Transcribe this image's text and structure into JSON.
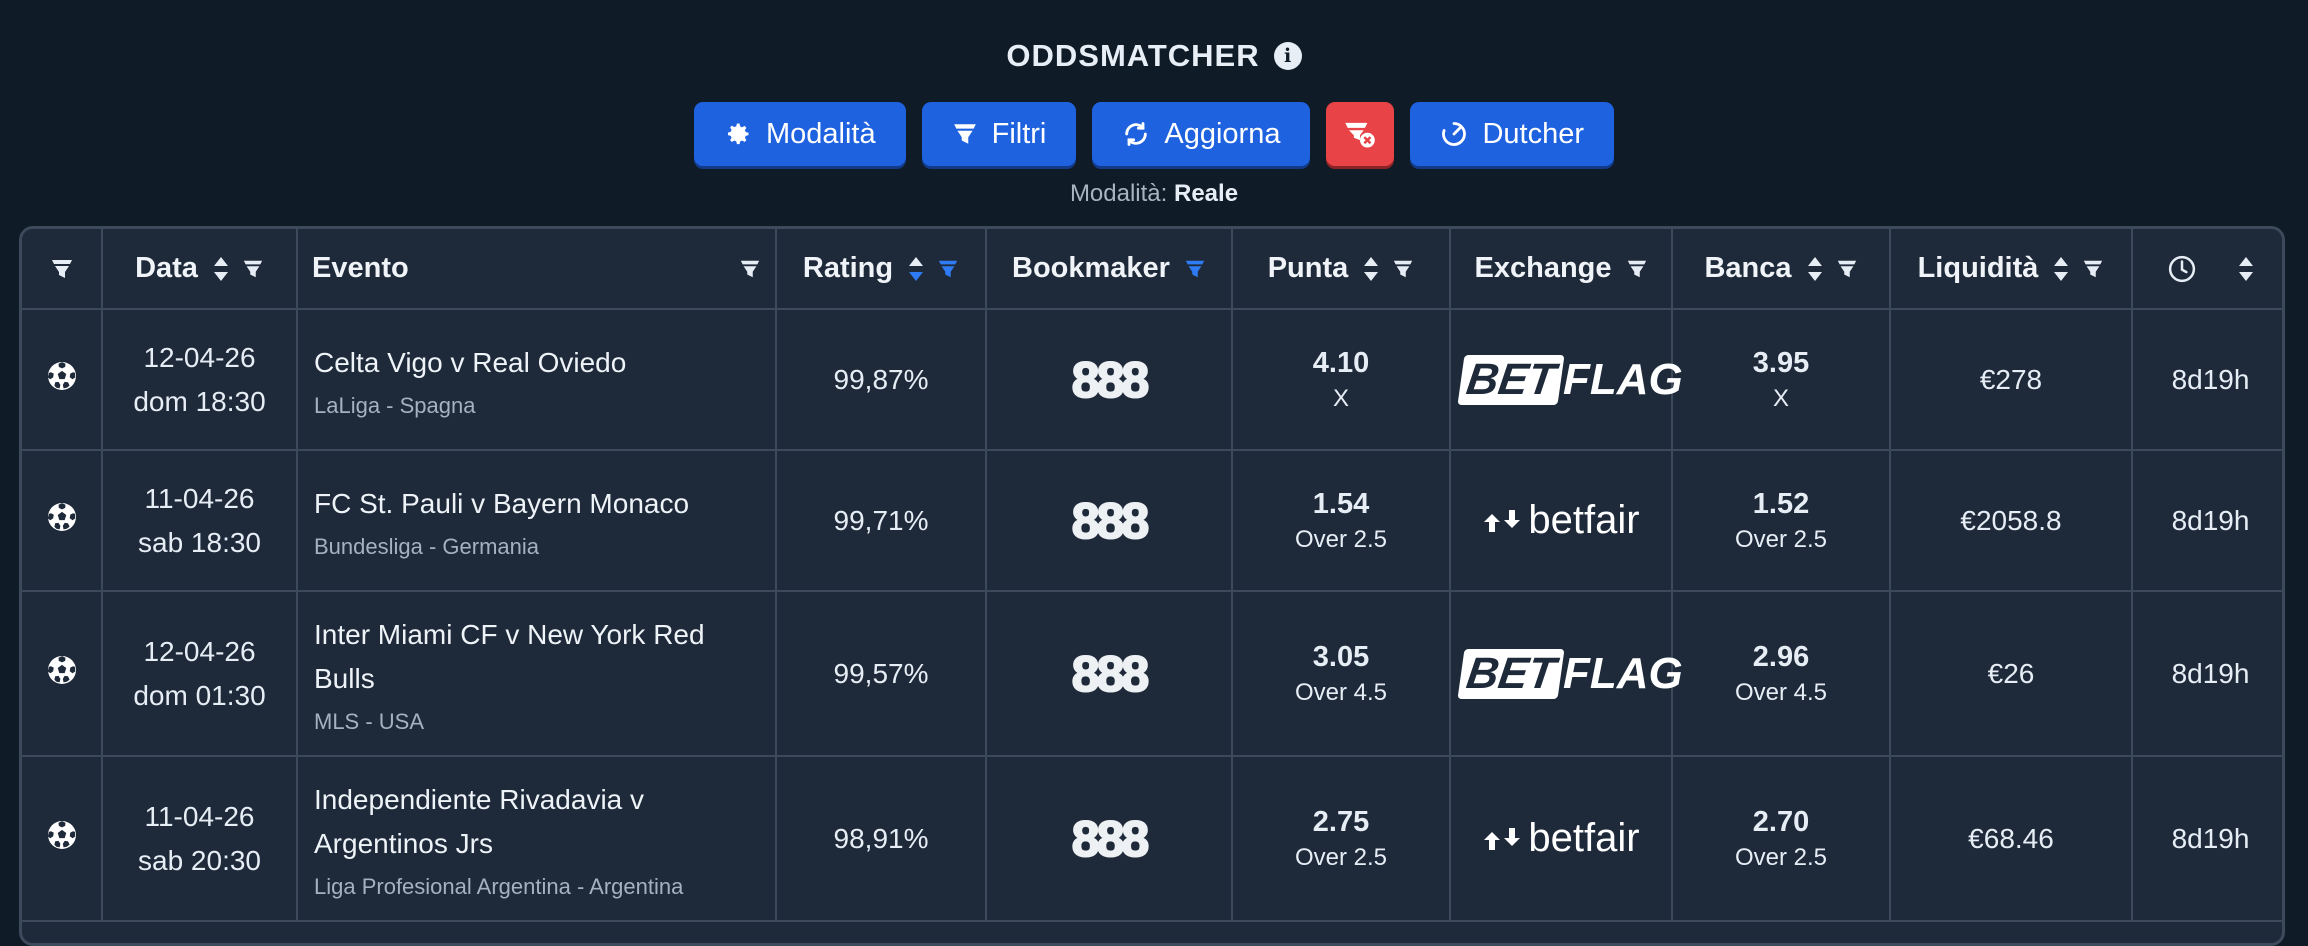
{
  "header": {
    "title": "ODDSMATCHER",
    "buttons": {
      "mode": "Modalità",
      "filters": "Filtri",
      "refresh": "Aggiorna",
      "dutcher": "Dutcher"
    },
    "mode_prefix": "Modalità:",
    "mode_value": "Reale"
  },
  "table": {
    "headers": {
      "date": "Data",
      "event": "Evento",
      "rating": "Rating",
      "bookmaker": "Bookmaker",
      "back": "Punta",
      "exchange": "Exchange",
      "lay": "Banca",
      "liquidity": "Liquidità"
    },
    "rows": [
      {
        "date": "12-04-26",
        "time": "dom 18:30",
        "event": "Celta Vigo v Real Oviedo",
        "league": "LaLiga - Spagna",
        "rating": "99,87%",
        "bookmaker": "888",
        "back_odd": "4.10",
        "back_market": "X",
        "exchange": "BETFLAG",
        "lay_odd": "3.95",
        "lay_market": "X",
        "liquidity": "€278",
        "expires": "8d19h"
      },
      {
        "date": "11-04-26",
        "time": "sab 18:30",
        "event": "FC St. Pauli v Bayern Monaco",
        "league": "Bundesliga - Germania",
        "rating": "99,71%",
        "bookmaker": "888",
        "back_odd": "1.54",
        "back_market": "Over 2.5",
        "exchange": "betfair",
        "lay_odd": "1.52",
        "lay_market": "Over 2.5",
        "liquidity": "€2058.8",
        "expires": "8d19h"
      },
      {
        "date": "12-04-26",
        "time": "dom 01:30",
        "event": "Inter Miami CF v New York Red Bulls",
        "league": "MLS - USA",
        "rating": "99,57%",
        "bookmaker": "888",
        "back_odd": "3.05",
        "back_market": "Over 4.5",
        "exchange": "BETFLAG",
        "lay_odd": "2.96",
        "lay_market": "Over 4.5",
        "liquidity": "€26",
        "expires": "8d19h"
      },
      {
        "date": "11-04-26",
        "time": "sab 20:30",
        "event": "Independiente Rivadavia v Argentinos Jrs",
        "league": "Liga Profesional Argentina - Argentina",
        "rating": "98,91%",
        "bookmaker": "888",
        "back_odd": "2.75",
        "back_market": "Over 2.5",
        "exchange": "betfair",
        "lay_odd": "2.70",
        "lay_market": "Over 2.5",
        "liquidity": "€68.46",
        "expires": "8d19h"
      }
    ]
  },
  "colors": {
    "background": "#0f1b27",
    "table_bg": "#1e2939",
    "primary_button": "#1f62e0",
    "danger_button": "#e84346",
    "active_filter": "#2f7bf5"
  },
  "icons": [
    "info-icon",
    "gear-icon",
    "filter-icon",
    "refresh-icon",
    "clear-filter-icon",
    "dutcher-icon",
    "sort-icon",
    "clock-icon",
    "soccer-ball-icon"
  ]
}
